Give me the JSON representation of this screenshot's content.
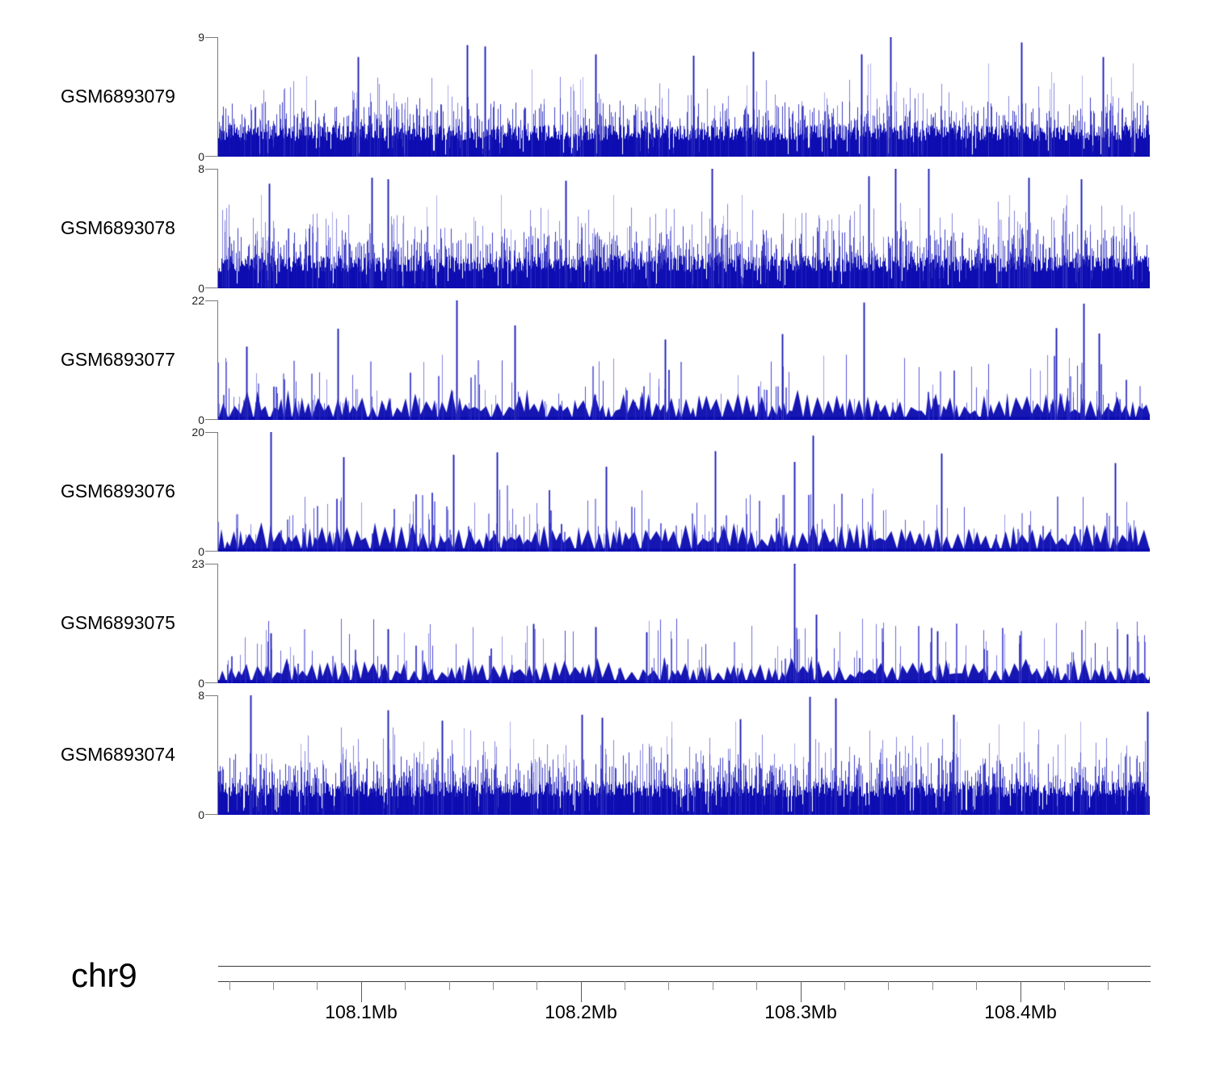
{
  "chart_data": {
    "type": "area",
    "title": "",
    "description": "Genome browser coverage tracks (signal pileup) for six GEO samples over a region of chromosome 9",
    "chromosome_label": "chr9",
    "region": {
      "chromosome": "chr9",
      "start_mb": 108.035,
      "end_mb": 108.459,
      "unit": "Mb"
    },
    "x_axis": {
      "major_ticks": [
        {
          "mb": 108.1,
          "label": "108.1Mb"
        },
        {
          "mb": 108.2,
          "label": "108.2Mb"
        },
        {
          "mb": 108.3,
          "label": "108.3Mb"
        },
        {
          "mb": 108.4,
          "label": "108.4Mb"
        }
      ],
      "minor_tick_interval_mb": 0.02,
      "minor_tick_start_mb": 108.04,
      "minor_tick_end_mb": 108.44
    },
    "y_axis": {
      "zero_label": "0"
    },
    "colors": {
      "signal": "#0c0cb0",
      "signal_mid": "rgba(16,16,180,0.80)",
      "signal_high": "rgba(55,55,200,0.62)",
      "signal_light": "rgba(95,95,215,0.50)",
      "peak_outer": "rgba(80,80,210,0.55)",
      "peak_core": "rgba(10,10,165,0.90)",
      "axis_bracket": "#7a7a7a",
      "ruler_line": "#3a3a3a",
      "tick_minor": "#8f8f8f",
      "tick_major": "#5a5a5a",
      "text": "#000000"
    },
    "tracks": [
      {
        "name": "GSM6893079",
        "ymin": 0,
        "ymax": 9,
        "style": "bar",
        "seed": 917,
        "base_units": [
          1.2,
          2.4
        ],
        "peaks": [
          [
            0.722,
            9.0
          ],
          [
            0.267,
            8.4
          ],
          [
            0.286,
            8.3
          ],
          [
            0.862,
            8.6
          ],
          [
            0.405,
            7.7
          ],
          [
            0.574,
            7.9
          ],
          [
            0.15,
            7.5
          ],
          [
            0.51,
            7.6
          ],
          [
            0.95,
            7.5
          ],
          [
            0.69,
            7.7
          ]
        ]
      },
      {
        "name": "GSM6893078",
        "ymin": 0,
        "ymax": 8,
        "style": "bar",
        "seed": 828,
        "base_units": [
          1.1,
          2.2
        ],
        "peaks": [
          [
            0.53,
            8.0
          ],
          [
            0.727,
            8.0
          ],
          [
            0.762,
            8.0
          ],
          [
            0.165,
            7.4
          ],
          [
            0.182,
            7.3
          ],
          [
            0.373,
            7.2
          ],
          [
            0.698,
            7.5
          ],
          [
            0.87,
            7.4
          ],
          [
            0.926,
            7.3
          ],
          [
            0.055,
            7.0
          ]
        ]
      },
      {
        "name": "GSM6893077",
        "ymin": 0,
        "ymax": 22,
        "style": "peak",
        "seed": 737,
        "base_units": [
          2.0,
          4.6
        ],
        "peaks": [
          [
            0.256,
            22.0
          ],
          [
            0.693,
            21.6
          ],
          [
            0.929,
            21.4
          ],
          [
            0.128,
            16.8
          ],
          [
            0.318,
            17.4
          ],
          [
            0.605,
            15.8
          ],
          [
            0.899,
            16.9
          ],
          [
            0.48,
            14.8
          ],
          [
            0.945,
            15.9
          ],
          [
            0.03,
            13.5
          ]
        ]
      },
      {
        "name": "GSM6893076",
        "ymin": 0,
        "ymax": 20,
        "style": "peak",
        "seed": 646,
        "base_units": [
          1.9,
          4.2
        ],
        "peaks": [
          [
            0.056,
            20.0
          ],
          [
            0.638,
            19.4
          ],
          [
            0.776,
            16.4
          ],
          [
            0.134,
            15.8
          ],
          [
            0.252,
            16.2
          ],
          [
            0.299,
            16.6
          ],
          [
            0.533,
            16.8
          ],
          [
            0.416,
            14.2
          ],
          [
            0.963,
            14.8
          ],
          [
            0.618,
            15.0
          ]
        ]
      },
      {
        "name": "GSM6893075",
        "ymin": 0,
        "ymax": 23,
        "style": "peak",
        "seed": 555,
        "base_units": [
          1.8,
          4.0
        ],
        "peaks": [
          [
            0.618,
            23.0
          ],
          [
            0.642,
            13.2
          ],
          [
            0.338,
            11.4
          ],
          [
            0.405,
            10.8
          ],
          [
            0.182,
            10.4
          ],
          [
            0.772,
            10.0
          ],
          [
            0.056,
            9.6
          ],
          [
            0.976,
            9.4
          ],
          [
            0.46,
            9.8
          ],
          [
            0.86,
            9.2
          ]
        ]
      },
      {
        "name": "GSM6893074",
        "ymin": 0,
        "ymax": 8,
        "style": "bar",
        "seed": 464,
        "base_units": [
          1.2,
          2.3
        ],
        "peaks": [
          [
            0.035,
            8.0
          ],
          [
            0.635,
            7.9
          ],
          [
            0.663,
            7.8
          ],
          [
            0.182,
            7.0
          ],
          [
            0.39,
            6.7
          ],
          [
            0.412,
            6.5
          ],
          [
            0.789,
            6.7
          ],
          [
            0.997,
            6.9
          ],
          [
            0.56,
            6.4
          ],
          [
            0.24,
            6.3
          ]
        ]
      }
    ]
  }
}
